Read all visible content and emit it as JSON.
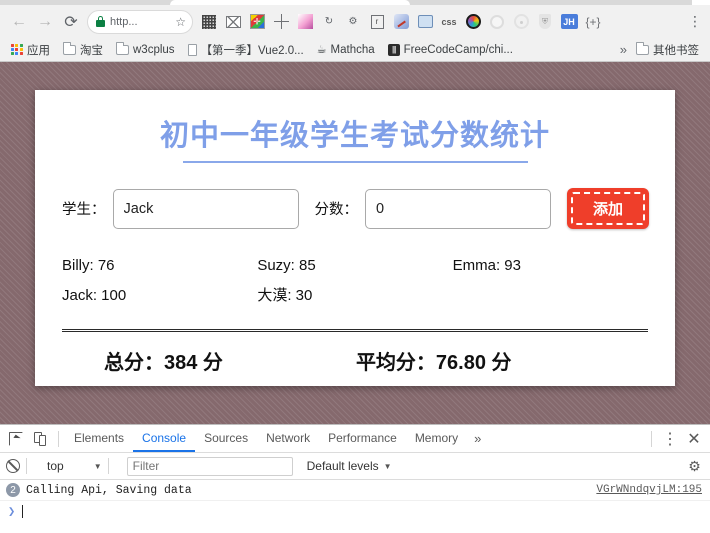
{
  "browser": {
    "nav": {
      "back": "←",
      "forward": "→",
      "reload": "⟳"
    },
    "omnibox": {
      "url": "http...",
      "lock_icon": "lock-icon",
      "star_icon": "star-icon",
      "star_glyph": "☆"
    },
    "extensions": [
      {
        "name": "qr-code-icon"
      },
      {
        "name": "mail-checker-icon"
      },
      {
        "name": "color-picker-icon"
      },
      {
        "name": "crosshair-ruler-icon"
      },
      {
        "name": "gradient-icon"
      },
      {
        "name": "refresh-extension-icon",
        "glyph": "↻"
      },
      {
        "name": "gear-extension-icon",
        "glyph": "⚙"
      },
      {
        "name": "ruler-icon",
        "glyph": "r"
      },
      {
        "name": "speedometer-icon"
      },
      {
        "name": "image-extension-icon"
      },
      {
        "name": "css-icon",
        "glyph": "css"
      },
      {
        "name": "color-wheel-icon"
      },
      {
        "name": "circle-icon"
      },
      {
        "name": "react-atom-icon"
      },
      {
        "name": "shield-icon",
        "glyph": "⛨"
      },
      {
        "name": "jh-badge-icon",
        "glyph": "JH"
      },
      {
        "name": "json-braces-icon",
        "glyph": "{+}"
      }
    ],
    "menu_icon": "⋮",
    "bookmarks": [
      {
        "label": "应用",
        "icon": "apps-grid-icon"
      },
      {
        "label": "淘宝",
        "icon": "folder-icon"
      },
      {
        "label": "w3cplus",
        "icon": "folder-icon"
      },
      {
        "label": "【第一季】Vue2.0...",
        "icon": "document-icon"
      },
      {
        "label": "Mathcha",
        "icon": "teacup-icon",
        "glyph": "☕"
      },
      {
        "label": "FreeCodeCamp/chi...",
        "icon": "freecodecamp-icon",
        "glyph": "|||"
      }
    ],
    "bookmarks_overflow": "»",
    "other_bookmarks": {
      "label": "其他书签",
      "icon": "folder-icon"
    }
  },
  "page": {
    "title": "初中一年级学生考试分数统计",
    "form": {
      "student_label": "学生：",
      "student_value": "Jack",
      "student_placeholder": "",
      "score_label": "分数：",
      "score_value": "0",
      "score_placeholder": "",
      "add_button": "添加"
    },
    "students": [
      {
        "name": "Billy",
        "score": 76,
        "text": "Billy: 76"
      },
      {
        "name": "Suzy",
        "score": 85,
        "text": "Suzy: 85"
      },
      {
        "name": "Emma",
        "score": 93,
        "text": "Emma: 93"
      },
      {
        "name": "Jack",
        "score": 100,
        "text": "Jack: 100"
      },
      {
        "name": "大漠",
        "score": 30,
        "text": "大漠: 30"
      }
    ],
    "totals": {
      "sum": "总分：384 分",
      "average": "平均分：76.80 分"
    },
    "colors": {
      "title": "#7f9fe8",
      "button": "#ef3e2a",
      "background": "#85696d"
    }
  },
  "devtools": {
    "inspect_icon": "inspect-cursor-icon",
    "device_icon": "device-toolbar-icon",
    "tabs": [
      {
        "label": "Elements",
        "active": false
      },
      {
        "label": "Console",
        "active": true
      },
      {
        "label": "Sources",
        "active": false
      },
      {
        "label": "Network",
        "active": false
      },
      {
        "label": "Performance",
        "active": false
      },
      {
        "label": "Memory",
        "active": false
      }
    ],
    "tabs_overflow": "»",
    "menu_icon": "⋮",
    "close_icon": "✕",
    "console_toolbar": {
      "clear_icon": "clear-console-icon",
      "context": "top",
      "context_caret": "▼",
      "filter_placeholder": "Filter",
      "filter_value": "",
      "levels": "Default levels",
      "levels_caret": "▼",
      "settings_icon": "⚙"
    },
    "messages": [
      {
        "count": "2",
        "text": "Calling Api, Saving data",
        "source": "VGrWNndqvjLM:195"
      }
    ],
    "prompt_caret": "❯"
  }
}
